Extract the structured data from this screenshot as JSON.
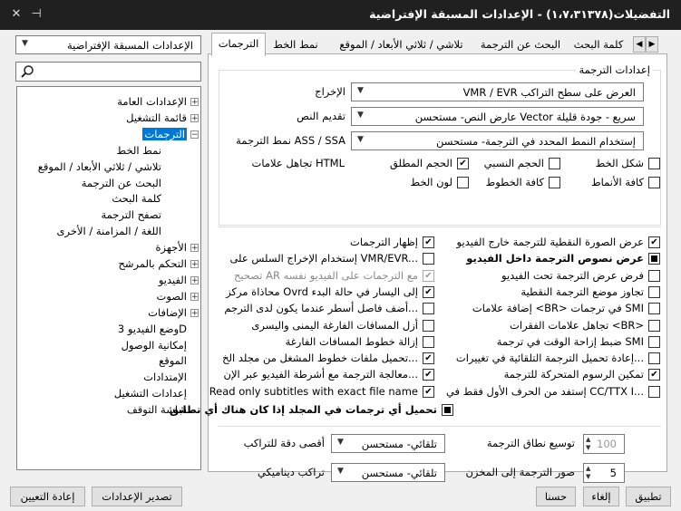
{
  "window": {
    "title": "التفضيلات(١،٧،٣١٣٧٨) - الإعدادات المسبقة الإفتراضية",
    "close_glyph": "✕",
    "pin_glyph": "⊣",
    "app_icon": "wrench-gear-icon"
  },
  "preset_combo": {
    "value": "الإعدادات المسبقة الإفتراضية"
  },
  "search": {
    "placeholder": ""
  },
  "tree": [
    {
      "label": "الإعدادات العامة",
      "level": 0,
      "exp": "+"
    },
    {
      "label": "قائمة التشغيل",
      "level": 0,
      "exp": "+"
    },
    {
      "label": "الترجمات",
      "level": 0,
      "exp": "-",
      "selected": true
    },
    {
      "label": "نمط الخط",
      "level": 1
    },
    {
      "label": "تلاشي / ثلاثي الأبعاد / الموقع",
      "level": 1
    },
    {
      "label": "البحث عن الترجمة",
      "level": 1
    },
    {
      "label": "كلمة البحث",
      "level": 1
    },
    {
      "label": "تصفح الترجمة",
      "level": 1
    },
    {
      "label": "اللغة / المزامنة / الأخرى",
      "level": 1
    },
    {
      "label": "الأجهزة",
      "level": 0,
      "exp": "+"
    },
    {
      "label": "التحكم بالمرشح",
      "level": 0,
      "exp": "+"
    },
    {
      "label": "الفيديو",
      "level": 0,
      "exp": "+"
    },
    {
      "label": "الصوت",
      "level": 0,
      "exp": "+"
    },
    {
      "label": "الإضافات",
      "level": 0,
      "exp": "+"
    },
    {
      "label": "وضع الفيديو 3D",
      "level": 0
    },
    {
      "label": "إمكانية الوصول",
      "level": 0
    },
    {
      "label": "الموقع",
      "level": 0
    },
    {
      "label": "الإمتدادات",
      "level": 0
    },
    {
      "label": "إعدادات التشغيل",
      "level": 0
    },
    {
      "label": "شاشة التوقف",
      "level": 0
    }
  ],
  "tabs": {
    "items": [
      "الترجمات",
      "نمط الخط",
      "تلاشي / ثلاثي الأبعاد / الموقع",
      "البحث عن الترجمة",
      "كلمة البحث"
    ],
    "left_arrow": "◀",
    "right_arrow": "▶"
  },
  "group_title": "إعدادات الترجمة",
  "rows": [
    {
      "label": "الإخراج",
      "value": "VMR / EVR العرض على سطح التراكب"
    },
    {
      "label": "تقديم النص",
      "value": "عارض النص- مستحسن Vector سريع - جودة قليلة"
    },
    {
      "label": "نمط الترجمة ASS / SSA",
      "value": "إستخدام النمط المحدد في الترجمة- مستحسن"
    }
  ],
  "html_tags": {
    "label": "تجاهل علامات HTML",
    "options": [
      {
        "label": "شكل الخط",
        "state": "off"
      },
      {
        "label": "الحجم النسبي",
        "state": "off"
      },
      {
        "label": "الحجم المطلق",
        "state": "on"
      },
      {
        "label": "كافة الأنماط",
        "state": "off"
      },
      {
        "label": "كافة الخطوط",
        "state": "off"
      },
      {
        "label": "لون الخط",
        "state": "off"
      }
    ]
  },
  "checks_right": [
    {
      "label": "عرض الصورة النقطية للترجمة خارج الفيديو",
      "state": "on"
    },
    {
      "label": "عرض نصوص الترجمة داخل الفيديو",
      "state": "ind",
      "bold": true
    },
    {
      "label": "فرض عرض الترجمة تحت الفيديو",
      "state": "off"
    },
    {
      "label": "تجاوز موضع الترجمة النقطية",
      "state": "off"
    },
    {
      "label": "إضافة علامات <BR> في ترجمات SMI",
      "state": "off"
    },
    {
      "label": "تجاهل علامات الفقرات <BR>",
      "state": "off"
    },
    {
      "label": "ضبط إزاحة الوقت في ترجمة SMI",
      "state": "off"
    },
    {
      "label": "إعادة تحميل الترجمة التلقائية في تغييرات...",
      "state": "off"
    },
    {
      "label": "تمكين الرسوم المتحركة للترجمة",
      "state": "on"
    },
    {
      "label": "إستفد من الحرف الأول فقط في CC/TTX I...",
      "state": "off"
    }
  ],
  "checks_left": [
    {
      "label": "إظهار الترجمات",
      "state": "on"
    },
    {
      "label": "إستخدام الإخراج السلس على VMR/EVR...",
      "state": "off"
    },
    {
      "label": "تصحيح AR مع الترجمات على الفيديو نفسه",
      "state": "on",
      "disabled": true
    },
    {
      "label": "محاذاة مركز Ovrd إلى اليسار في حالة البدء",
      "state": "on"
    },
    {
      "label": "أضف فاصل أسطر عندما يكون لدى الترجم...",
      "state": "off"
    },
    {
      "label": "أزل المسافات الفارغة اليمنى واليسرى",
      "state": "off"
    },
    {
      "label": "إزالة خطوط المسافات الفارغة",
      "state": "off"
    },
    {
      "label": "تحميل ملفات خطوط المشغل من مجلد الخ...",
      "state": "on"
    },
    {
      "label": "معالجة الترجمة مع أشرطة الفيديو عبر الإن...",
      "state": "on"
    },
    {
      "label": "Read only subtitles with exact file name",
      "state": "on"
    }
  ],
  "check_bottom": {
    "label": "تحميل أي ترجمات في المجلد إذا كان هناك أي تطابق",
    "state": "ind",
    "bold": true
  },
  "bottom_fields": {
    "expand_label": "توسيع نطاق الترجمة",
    "expand_value": "100",
    "max_res_label": "أقصى دقة للتراكب",
    "max_res_value": "تلقائي- مستحسن",
    "cache_label": "صور الترجمة إلى المخزن",
    "cache_value": "5",
    "dyn_label": "تراكب ديناميكي",
    "dyn_value": "تلقائي- مستحسن"
  },
  "buttons": {
    "apply": "تطبيق",
    "cancel": "إلغاء",
    "ok": "حسنا",
    "export": "تصدير الإعدادات",
    "reset": "إعادة التعيين"
  }
}
